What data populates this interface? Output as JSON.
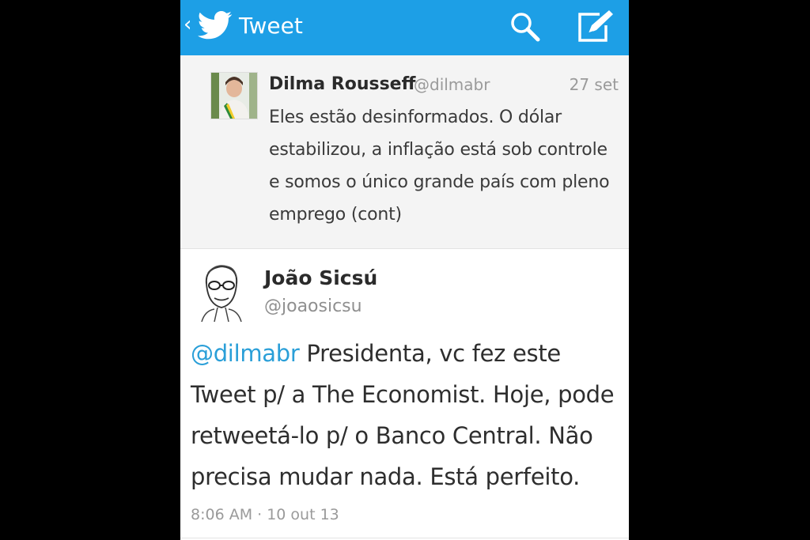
{
  "header": {
    "back_glyph": "‹",
    "title": "Tweet",
    "icons": [
      "twitter-bird-icon",
      "search-icon",
      "compose-icon"
    ],
    "bar_color": "#1d9fe6"
  },
  "quoted_tweet": {
    "author_name": "Dilma Rousseff",
    "author_handle": "@dilmabr",
    "date": "27 set",
    "text": "Eles estão desinformados. O dólar estabilizou, a inflação está sob controle e somos o único grande país com pleno emprego (cont)"
  },
  "tweet": {
    "author_name": "João Sicsú",
    "author_handle": "@joaosicsu",
    "mention": "@dilmabr",
    "text": " Presidenta, vc fez este Tweet p/ a The Economist. Hoje, pode retweetá-lo p/ o Banco Central. Não precisa mudar nada. Está perfeito.",
    "meta": "8:06 AM · 10 out 13",
    "mention_color": "#2a9fd8"
  }
}
